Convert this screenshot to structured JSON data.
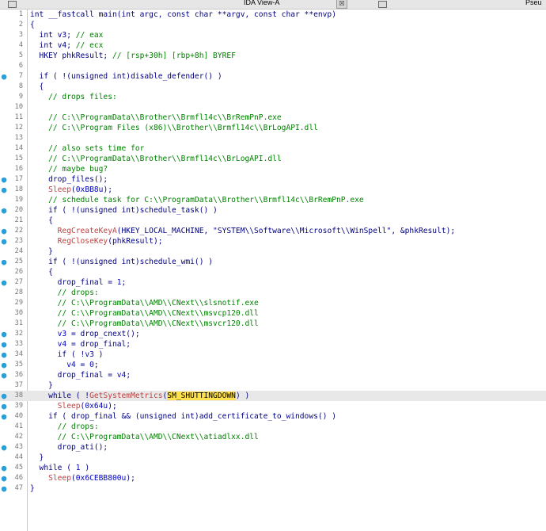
{
  "tabbar": {
    "title": "IDA View-A",
    "close": "☒",
    "pseudo_tab": "Pseu"
  },
  "code": {
    "lines": [
      {
        "n": "1",
        "bp": false,
        "hl": false,
        "t": [
          [
            "int __fastcall main(int argc, const char **argv, const char **envp)",
            "p"
          ]
        ]
      },
      {
        "n": "2",
        "bp": false,
        "hl": false,
        "t": [
          [
            "{",
            "p"
          ]
        ]
      },
      {
        "n": "3",
        "bp": false,
        "hl": false,
        "t": [
          [
            "  int v3; ",
            "p"
          ],
          [
            "// eax",
            "cm"
          ]
        ]
      },
      {
        "n": "4",
        "bp": false,
        "hl": false,
        "t": [
          [
            "  int v4; ",
            "p"
          ],
          [
            "// ecx",
            "cm"
          ]
        ]
      },
      {
        "n": "5",
        "bp": false,
        "hl": false,
        "t": [
          [
            "  HKEY phkResult; ",
            "p"
          ],
          [
            "// [rsp+30h] [rbp+8h] BYREF",
            "cm"
          ]
        ]
      },
      {
        "n": "6",
        "bp": false,
        "hl": false,
        "t": [
          [
            "",
            "p"
          ]
        ]
      },
      {
        "n": "7",
        "bp": true,
        "hl": false,
        "t": [
          [
            "  if ( !(unsigned int)disable_defender() )",
            "p"
          ]
        ]
      },
      {
        "n": "8",
        "bp": false,
        "hl": false,
        "t": [
          [
            "  {",
            "p"
          ]
        ]
      },
      {
        "n": "9",
        "bp": false,
        "hl": false,
        "t": [
          [
            "    ",
            "p"
          ],
          [
            "// drops files:",
            "cm"
          ]
        ]
      },
      {
        "n": "10",
        "bp": false,
        "hl": false,
        "t": [
          [
            "",
            "p"
          ]
        ]
      },
      {
        "n": "11",
        "bp": false,
        "hl": false,
        "t": [
          [
            "    ",
            "p"
          ],
          [
            "// C:\\\\ProgramData\\\\Brother\\\\Brmfl14c\\\\BrRemPnP.exe",
            "cm"
          ]
        ]
      },
      {
        "n": "12",
        "bp": false,
        "hl": false,
        "t": [
          [
            "    ",
            "p"
          ],
          [
            "// C:\\\\Program Files (x86)\\\\Brother\\\\Brmfl14c\\\\BrLogAPI.dll",
            "cm"
          ]
        ]
      },
      {
        "n": "13",
        "bp": false,
        "hl": false,
        "t": [
          [
            "",
            "p"
          ]
        ]
      },
      {
        "n": "14",
        "bp": false,
        "hl": false,
        "t": [
          [
            "    ",
            "p"
          ],
          [
            "// also sets time for",
            "cm"
          ]
        ]
      },
      {
        "n": "15",
        "bp": false,
        "hl": false,
        "t": [
          [
            "    ",
            "p"
          ],
          [
            "// C:\\\\ProgramData\\\\Brother\\\\Brmfl14c\\\\BrLogAPI.dll",
            "cm"
          ]
        ]
      },
      {
        "n": "16",
        "bp": false,
        "hl": false,
        "t": [
          [
            "    ",
            "p"
          ],
          [
            "// maybe bug?",
            "cm"
          ]
        ]
      },
      {
        "n": "17",
        "bp": true,
        "hl": false,
        "t": [
          [
            "    drop_files();",
            "p"
          ]
        ]
      },
      {
        "n": "18",
        "bp": true,
        "hl": false,
        "t": [
          [
            "    ",
            "p"
          ],
          [
            "Sleep",
            "fn"
          ],
          [
            "(",
            "p"
          ],
          [
            "0xBB8u",
            "nm"
          ],
          [
            ");",
            "p"
          ]
        ]
      },
      {
        "n": "19",
        "bp": false,
        "hl": false,
        "t": [
          [
            "    ",
            "p"
          ],
          [
            "// schedule task for C:\\\\ProgramData\\\\Brother\\\\Brmfl14c\\\\BrRemPnP.exe",
            "cm"
          ]
        ]
      },
      {
        "n": "20",
        "bp": true,
        "hl": false,
        "t": [
          [
            "    if ( !(unsigned int)schedule_task() )",
            "p"
          ]
        ]
      },
      {
        "n": "21",
        "bp": false,
        "hl": false,
        "t": [
          [
            "    {",
            "p"
          ]
        ]
      },
      {
        "n": "22",
        "bp": true,
        "hl": false,
        "t": [
          [
            "      ",
            "p"
          ],
          [
            "RegCreateKeyA",
            "fn"
          ],
          [
            "(HKEY_LOCAL_MACHINE, ",
            "p"
          ],
          [
            "\"SYSTEM\\\\Software\\\\Microsoft\\\\WinSpell\"",
            "st"
          ],
          [
            ", &phkResult);",
            "p"
          ]
        ]
      },
      {
        "n": "23",
        "bp": true,
        "hl": false,
        "t": [
          [
            "      ",
            "p"
          ],
          [
            "RegCloseKey",
            "fn"
          ],
          [
            "(phkResult);",
            "p"
          ]
        ]
      },
      {
        "n": "24",
        "bp": false,
        "hl": false,
        "t": [
          [
            "    }",
            "p"
          ]
        ]
      },
      {
        "n": "25",
        "bp": true,
        "hl": false,
        "t": [
          [
            "    if ( !(unsigned int)schedule_wmi() )",
            "p"
          ]
        ]
      },
      {
        "n": "26",
        "bp": false,
        "hl": false,
        "t": [
          [
            "    {",
            "p"
          ]
        ]
      },
      {
        "n": "27",
        "bp": true,
        "hl": false,
        "t": [
          [
            "      drop_final = ",
            "p"
          ],
          [
            "1",
            "nm"
          ],
          [
            ";",
            "p"
          ]
        ]
      },
      {
        "n": "28",
        "bp": false,
        "hl": false,
        "t": [
          [
            "      ",
            "p"
          ],
          [
            "// drops:",
            "cm"
          ]
        ]
      },
      {
        "n": "29",
        "bp": false,
        "hl": false,
        "t": [
          [
            "      ",
            "p"
          ],
          [
            "// C:\\\\ProgramData\\\\AMD\\\\CNext\\\\slsnotif.exe",
            "cm"
          ]
        ]
      },
      {
        "n": "30",
        "bp": false,
        "hl": false,
        "t": [
          [
            "      ",
            "p"
          ],
          [
            "// C:\\\\ProgramData\\\\AMD\\\\CNext\\\\msvcp120.dll",
            "cm"
          ]
        ]
      },
      {
        "n": "31",
        "bp": false,
        "hl": false,
        "t": [
          [
            "      ",
            "p"
          ],
          [
            "// C:\\\\ProgramData\\\\AMD\\\\CNext\\\\msvcr120.dll",
            "cm"
          ]
        ]
      },
      {
        "n": "32",
        "bp": true,
        "hl": false,
        "t": [
          [
            "      ",
            "p"
          ],
          [
            "v3",
            "nm"
          ],
          [
            " = drop_cnext();",
            "p"
          ]
        ]
      },
      {
        "n": "33",
        "bp": true,
        "hl": false,
        "t": [
          [
            "      ",
            "p"
          ],
          [
            "v4",
            "nm"
          ],
          [
            " = drop_final;",
            "p"
          ]
        ]
      },
      {
        "n": "34",
        "bp": true,
        "hl": false,
        "t": [
          [
            "      if ( !",
            "p"
          ],
          [
            "v3",
            "nm"
          ],
          [
            " )",
            "p"
          ]
        ]
      },
      {
        "n": "35",
        "bp": true,
        "hl": false,
        "t": [
          [
            "        ",
            "p"
          ],
          [
            "v4",
            "nm"
          ],
          [
            " = ",
            "p"
          ],
          [
            "0",
            "nm"
          ],
          [
            ";",
            "p"
          ]
        ]
      },
      {
        "n": "36",
        "bp": true,
        "hl": false,
        "t": [
          [
            "      drop_final = ",
            "p"
          ],
          [
            "v4",
            "nm"
          ],
          [
            ";",
            "p"
          ]
        ]
      },
      {
        "n": "37",
        "bp": false,
        "hl": false,
        "t": [
          [
            "    }",
            "p"
          ]
        ]
      },
      {
        "n": "38",
        "bp": true,
        "hl": true,
        "t": [
          [
            "    while ( !",
            "p"
          ],
          [
            "GetSystemMetrics",
            "fn"
          ],
          [
            "(",
            "p"
          ],
          [
            "SM_SHUTTINGDOWN",
            "mark"
          ],
          [
            ") )",
            "p"
          ]
        ]
      },
      {
        "n": "39",
        "bp": true,
        "hl": false,
        "t": [
          [
            "      ",
            "p"
          ],
          [
            "Sleep",
            "fn"
          ],
          [
            "(",
            "p"
          ],
          [
            "0x64u",
            "nm"
          ],
          [
            ");",
            "p"
          ]
        ]
      },
      {
        "n": "40",
        "bp": true,
        "hl": false,
        "t": [
          [
            "    if ( drop_final && (unsigned int)add_certificate_to_windows() )",
            "p"
          ]
        ]
      },
      {
        "n": "41",
        "bp": false,
        "hl": false,
        "t": [
          [
            "      ",
            "p"
          ],
          [
            "// drops:",
            "cm"
          ]
        ]
      },
      {
        "n": "42",
        "bp": false,
        "hl": false,
        "t": [
          [
            "      ",
            "p"
          ],
          [
            "// C:\\\\ProgramData\\\\AMD\\\\CNext\\\\atiadlxx.dll",
            "cm"
          ]
        ]
      },
      {
        "n": "43",
        "bp": true,
        "hl": false,
        "t": [
          [
            "      drop_ati();",
            "p"
          ]
        ]
      },
      {
        "n": "44",
        "bp": false,
        "hl": false,
        "t": [
          [
            "  }",
            "p"
          ]
        ]
      },
      {
        "n": "45",
        "bp": true,
        "hl": false,
        "t": [
          [
            "  while ( ",
            "p"
          ],
          [
            "1",
            "nm"
          ],
          [
            " )",
            "p"
          ]
        ]
      },
      {
        "n": "46",
        "bp": true,
        "hl": false,
        "t": [
          [
            "    ",
            "p"
          ],
          [
            "Sleep",
            "fn"
          ],
          [
            "(",
            "p"
          ],
          [
            "0x6CEBB800u",
            "nm"
          ],
          [
            ");",
            "p"
          ]
        ]
      },
      {
        "n": "47",
        "bp": true,
        "hl": false,
        "t": [
          [
            "}",
            "p"
          ]
        ]
      }
    ]
  }
}
